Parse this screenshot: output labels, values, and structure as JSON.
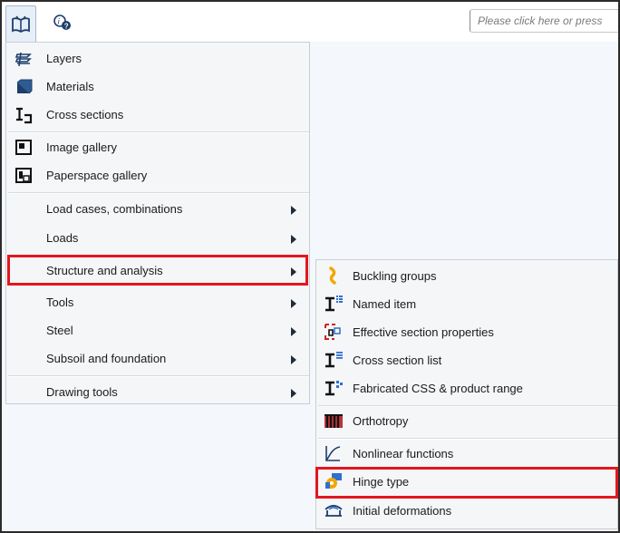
{
  "toolbar": {
    "book_icon": "open-book-icon",
    "help_icon": "help-search-icon",
    "search_placeholder": "Please click here or press"
  },
  "main_menu": {
    "items": [
      {
        "label": "Layers",
        "icon": "layers-icon"
      },
      {
        "label": "Materials",
        "icon": "materials-icon"
      },
      {
        "label": "Cross sections",
        "icon": "cross-sections-icon"
      },
      {
        "label": "Image gallery",
        "icon": "image-gallery-icon"
      },
      {
        "label": "Paperspace gallery",
        "icon": "paperspace-gallery-icon"
      },
      {
        "label": "Load cases, combinations"
      },
      {
        "label": "Loads"
      },
      {
        "label": "Structure and analysis"
      },
      {
        "label": "Tools"
      },
      {
        "label": "Steel"
      },
      {
        "label": "Subsoil and foundation"
      },
      {
        "label": "Drawing tools"
      }
    ]
  },
  "sub_menu": {
    "items": [
      {
        "label": "Buckling groups",
        "icon": "buckling-groups-icon"
      },
      {
        "label": "Named item",
        "icon": "named-item-icon"
      },
      {
        "label": "Effective section properties",
        "icon": "effective-section-icon"
      },
      {
        "label": "Cross section list",
        "icon": "cross-section-list-icon"
      },
      {
        "label": "Fabricated CSS & product range",
        "icon": "fabricated-css-icon"
      },
      {
        "label": "Orthotropy",
        "icon": "orthotropy-icon"
      },
      {
        "label": "Nonlinear functions",
        "icon": "nonlinear-functions-icon"
      },
      {
        "label": "Hinge type",
        "icon": "hinge-type-icon"
      },
      {
        "label": "Initial deformations",
        "icon": "initial-deformations-icon"
      }
    ]
  },
  "highlight_color": "#e4161f"
}
